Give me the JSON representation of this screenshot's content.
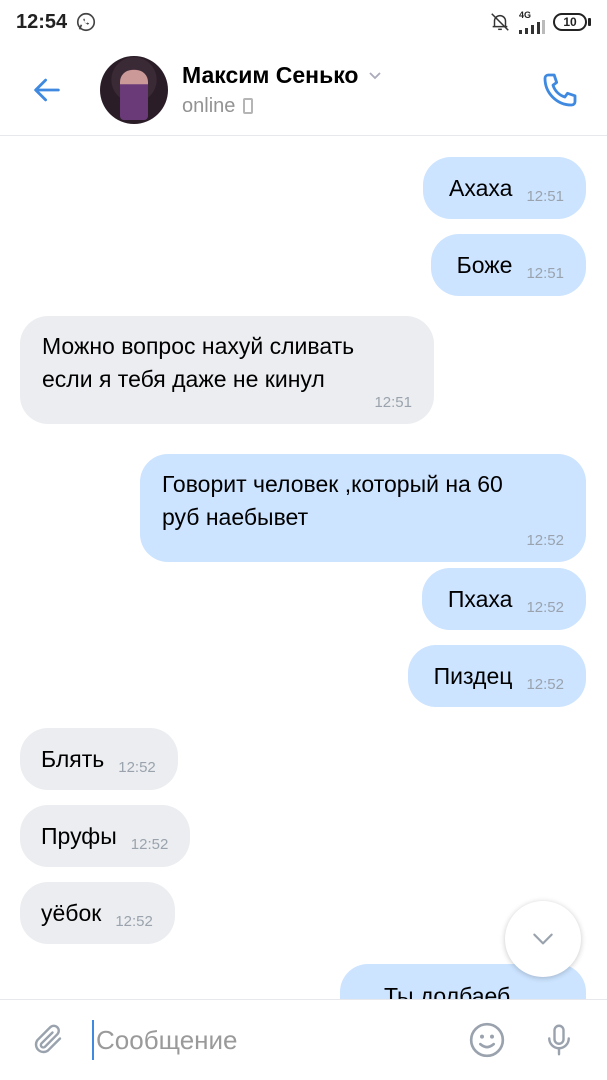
{
  "status_bar": {
    "time": "12:54",
    "network": "4G",
    "battery": "10",
    "icons": [
      "whatsapp-icon",
      "mute-bell-icon",
      "signal-icon",
      "battery-icon"
    ]
  },
  "header": {
    "name": "Максим Сенько",
    "status": "online",
    "icons": [
      "back-arrow-icon",
      "chevron-down-icon",
      "mobile-phone-icon",
      "phone-call-icon"
    ]
  },
  "messages": [
    {
      "dir": "out",
      "text": "Ахаха",
      "time": "12:51"
    },
    {
      "dir": "out",
      "text": "Боже",
      "time": "12:51"
    },
    {
      "dir": "in",
      "text": "Можно вопрос нахуй сливать\nесли я тебя даже не кинул",
      "time": "12:51"
    },
    {
      "dir": "out",
      "text": "Говорит человек ,который на 60\nруб наебывет",
      "time": "12:52"
    },
    {
      "dir": "out",
      "text": "Пхаха",
      "time": "12:52"
    },
    {
      "dir": "out",
      "text": "Пиздец",
      "time": "12:52"
    },
    {
      "dir": "in",
      "text": "Блять",
      "time": "12:52"
    },
    {
      "dir": "in",
      "text": "Пруфы",
      "time": "12:52"
    },
    {
      "dir": "in",
      "text": "уёбок",
      "time": "12:52"
    },
    {
      "dir": "out",
      "text": "Ты долбаеб",
      "time": ""
    }
  ],
  "composer": {
    "placeholder": "Сообщение",
    "icons": [
      "attach-icon",
      "emoji-icon",
      "microphone-icon"
    ]
  },
  "colors": {
    "accent": "#3f8ae0",
    "outgoing_bubble": "#cce4ff",
    "incoming_bubble": "#ebedf0",
    "time_text": "#9aa3ad"
  }
}
